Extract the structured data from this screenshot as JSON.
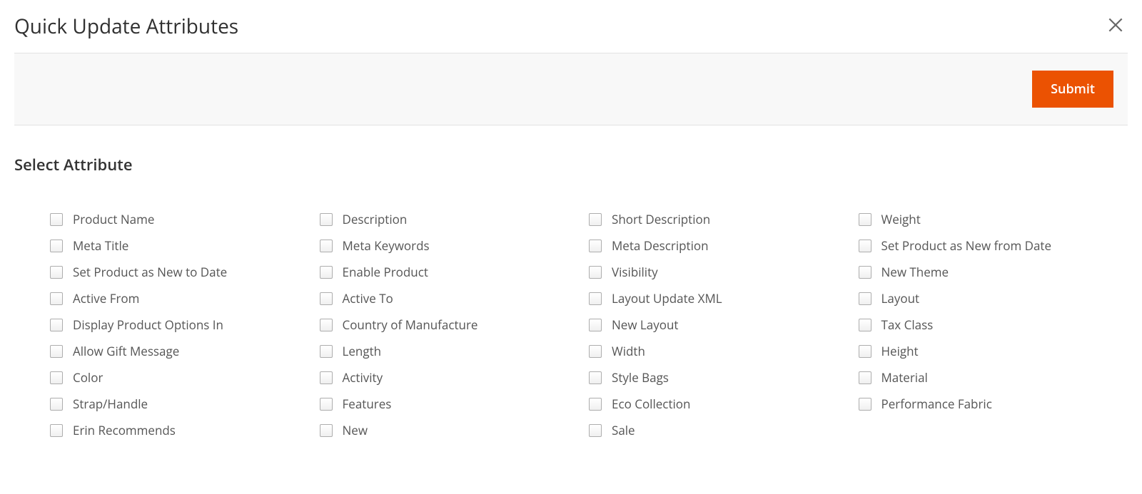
{
  "modal": {
    "title": "Quick Update Attributes",
    "submit_label": "Submit"
  },
  "section": {
    "title": "Select Attribute"
  },
  "attributes": {
    "col1": [
      "Product Name",
      "Meta Title",
      "Set Product as New to Date",
      "Active From",
      "Display Product Options In",
      "Allow Gift Message",
      "Color",
      "Strap/Handle",
      "Erin Recommends"
    ],
    "col2": [
      "Description",
      "Meta Keywords",
      "Enable Product",
      "Active To",
      "Country of Manufacture",
      "Length",
      "Activity",
      "Features",
      "New"
    ],
    "col3": [
      "Short Description",
      "Meta Description",
      "Visibility",
      "Layout Update XML",
      "New Layout",
      "Width",
      "Style Bags",
      "Eco Collection",
      "Sale"
    ],
    "col4": [
      "Weight",
      "Set Product as New from Date",
      "New Theme",
      "Layout",
      "Tax Class",
      "Height",
      "Material",
      "Performance Fabric"
    ]
  }
}
